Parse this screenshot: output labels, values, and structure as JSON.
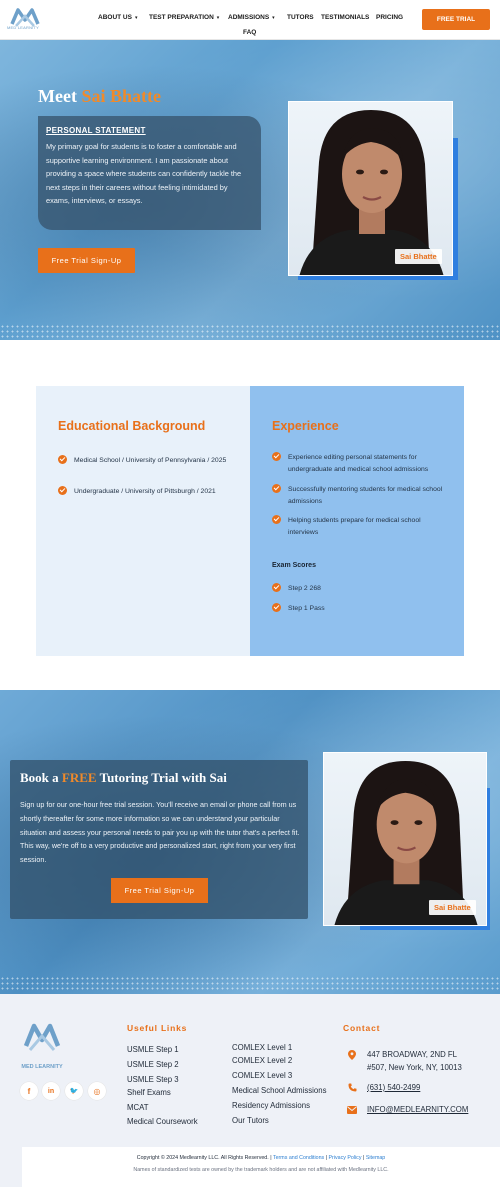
{
  "header": {
    "logo_text": "MED LEARNITY",
    "nav": [
      {
        "label": "ABOUT US",
        "has_menu": true
      },
      {
        "label": "TEST PREPARATION",
        "has_menu": true
      },
      {
        "label": "ADMISSIONS",
        "has_menu": true
      },
      {
        "label": "TUTORS",
        "has_menu": false
      },
      {
        "label": "TESTIMONIALS",
        "has_menu": false
      },
      {
        "label": "PRICING",
        "has_menu": false
      },
      {
        "label": "FAQ",
        "has_menu": false
      }
    ],
    "caret": "▾",
    "cta_label": "FREE TRIAL"
  },
  "hero": {
    "title_prefix": "Meet ",
    "title_name": "Sai Bhatte",
    "statement_heading": "PERSONAL STATEMENT",
    "statement_body": "My primary goal for students is to foster a comfortable and supportive learning environment. I am passionate about providing a space where students can confidently tackle the next steps in their careers without feeling intimidated by exams, interviews, or essays.",
    "cta_label": "Free Trial Sign-Up",
    "photo_name_tag": "Sai Bhatte"
  },
  "education": {
    "title": "Educational Background",
    "items": [
      "Medical School / University of Pennsylvania / 2025",
      "Undergraduate / University of Pittsburgh / 2021"
    ]
  },
  "experience": {
    "title": "Experience",
    "items": [
      "Experience editing personal statements for undergraduate and medical school admissions",
      "Successfully mentoring students for medical school admissions",
      "Helping students prepare for medical school interviews"
    ],
    "scores_title": "Exam Scores",
    "scores": [
      "Step 2 268",
      "Step 1 Pass"
    ]
  },
  "booking": {
    "title_a": "Book a ",
    "title_free": "FREE",
    "title_b": " Tutoring Trial with Sai",
    "body": "Sign up for our one-hour free trial session. You'll receive an email or phone call from us shortly thereafter for some more information so we can understand your particular situation and assess your personal needs to pair you up with the tutor that's a perfect fit. This way, we're off to a very productive and personalized start, right from your very first session.",
    "cta_label": "Free Trial Sign-Up",
    "photo_name_tag": "Sai Bhatte"
  },
  "footer": {
    "logo_text": "MED LEARNITY",
    "social": [
      {
        "icon": "facebook-icon",
        "glyph": "f"
      },
      {
        "icon": "linkedin-icon",
        "glyph": "in"
      },
      {
        "icon": "twitter-icon",
        "glyph": "🐦"
      },
      {
        "icon": "instagram-icon",
        "glyph": "◎"
      }
    ],
    "useful_links_heading": "Useful Links",
    "links_col1": [
      "USMLE Step 1",
      "USMLE Step 2",
      "USMLE Step 3",
      "Shelf Exams",
      "MCAT",
      "Medical Coursework"
    ],
    "links_col2": [
      "COMLEX Level 1",
      "COMLEX Level 2",
      "COMLEX Level 3",
      "Medical School Admissions",
      "Residency Admissions",
      "Our Tutors"
    ],
    "contact_heading": "Contact",
    "address_line1": "447 BROADWAY, 2ND FL",
    "address_line2": "#507, New York, NY, 10013",
    "phone": "(631) 540-2499",
    "email": "INFO@MEDLEARNITY.COM",
    "copyright": "Copyright © 2024 Medlearnity LLC. All Rights Reserved. | ",
    "terms": "Terms and Conditions",
    "privacy": "Privacy Policy",
    "sitemap": "Sitemap",
    "separator": " | ",
    "disclaimer": "Names of standardized tests are owned by the trademark holders and are not affiliated with Medlearnity LLC."
  },
  "colors": {
    "accent": "#e8701a",
    "panel_blue": "#90c0ee",
    "panel_light": "#e8f1fa",
    "photo_frame": "#2f7fe0"
  }
}
